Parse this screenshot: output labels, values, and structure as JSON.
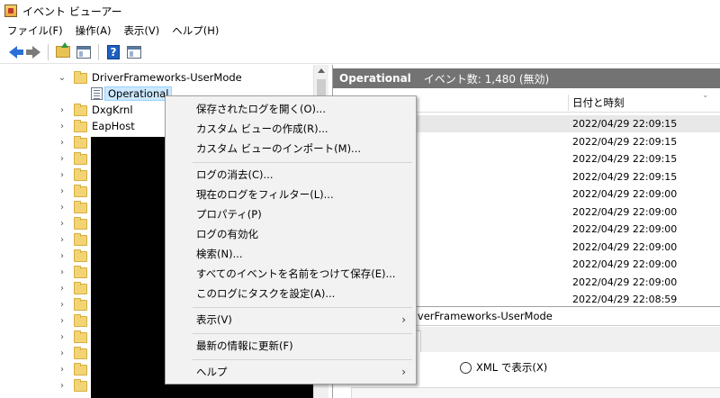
{
  "window": {
    "title": "イベント ビューアー"
  },
  "menubar": {
    "items": [
      "ファイル(F)",
      "操作(A)",
      "表示(V)",
      "ヘルプ(H)"
    ]
  },
  "tree": {
    "items": [
      {
        "label": "DriverFrameworks-UserMode",
        "expanded": true
      },
      {
        "label": "Operational",
        "selected": true
      },
      {
        "label": "DxgKrnl"
      },
      {
        "label": "EapHost"
      }
    ]
  },
  "right_pane": {
    "header_title": "Operational",
    "header_count": "イベント数: 1,480 (無効)",
    "column_date": "日付と時刻",
    "rows": [
      "2022/04/29 22:09:15",
      "2022/04/29 22:09:15",
      "2022/04/29 22:09:15",
      "2022/04/29 22:09:15",
      "2022/04/29 22:09:00",
      "2022/04/29 22:09:00",
      "2022/04/29 22:09:00",
      "2022/04/29 22:09:00",
      "2022/04/29 22:09:00",
      "2022/04/29 22:09:00",
      "2022/04/29 22:08:59"
    ],
    "detail_title": "riverFrameworks-UserMode",
    "xml_radio_label": "XML で表示(X)"
  },
  "context_menu": {
    "items": [
      "保存されたログを開く(O)...",
      "カスタム ビューの作成(R)...",
      "カスタム ビューのインポート(M)...",
      "ログの消去(C)...",
      "現在のログをフィルター(L)...",
      "プロパティ(P)",
      "ログの有効化",
      "検索(N)...",
      "すべてのイベントを名前をつけて保存(E)...",
      "このログにタスクを設定(A)...",
      "表示(V)",
      "最新の情報に更新(F)",
      "ヘルプ"
    ]
  },
  "icons": {
    "back": "back-arrow-icon",
    "forward": "forward-arrow-icon",
    "up": "folder-up-icon",
    "show_hide": "show-hide-pane-icon",
    "help": "help-icon",
    "action_pane": "action-pane-icon",
    "submenu": "chevron-right-icon"
  },
  "colors": {
    "header_bg": "#737373",
    "selection": "#cce8ff",
    "menu_bg": "#f2f2f2",
    "accent": "#2a6fd6"
  }
}
